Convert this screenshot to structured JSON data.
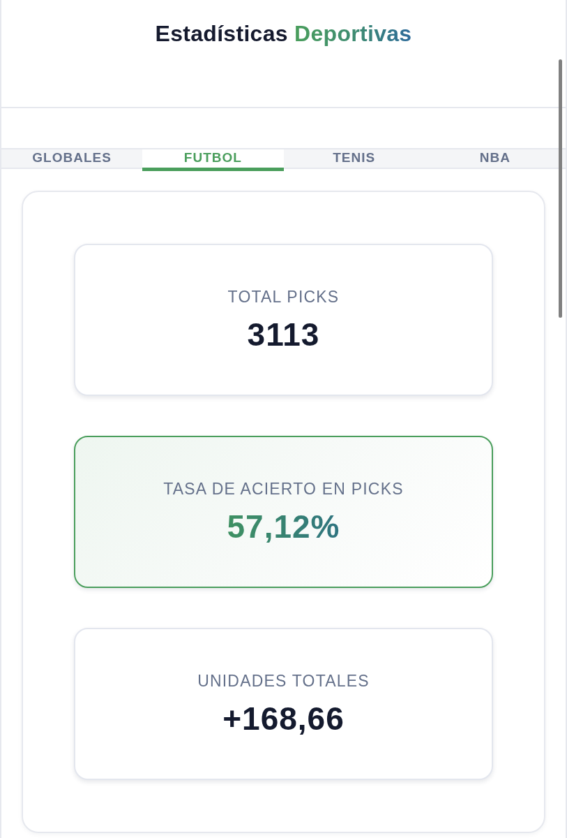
{
  "header": {
    "title": "Estadísticas",
    "title_accent": "Deportivas"
  },
  "tabs": [
    {
      "label": "GLOBALES",
      "selected": false
    },
    {
      "label": "FUTBOL",
      "selected": true
    },
    {
      "label": "TENIS",
      "selected": false
    },
    {
      "label": "NBA",
      "selected": false
    }
  ],
  "stats": [
    {
      "label": "TOTAL PICKS",
      "value": "3113",
      "highlighted": false
    },
    {
      "label": "TASA DE ACIERTO EN PICKS",
      "value": "57,12%",
      "highlighted": true
    },
    {
      "label": "UNIDADES TOTALES",
      "value": "+168,66",
      "highlighted": false
    }
  ]
}
